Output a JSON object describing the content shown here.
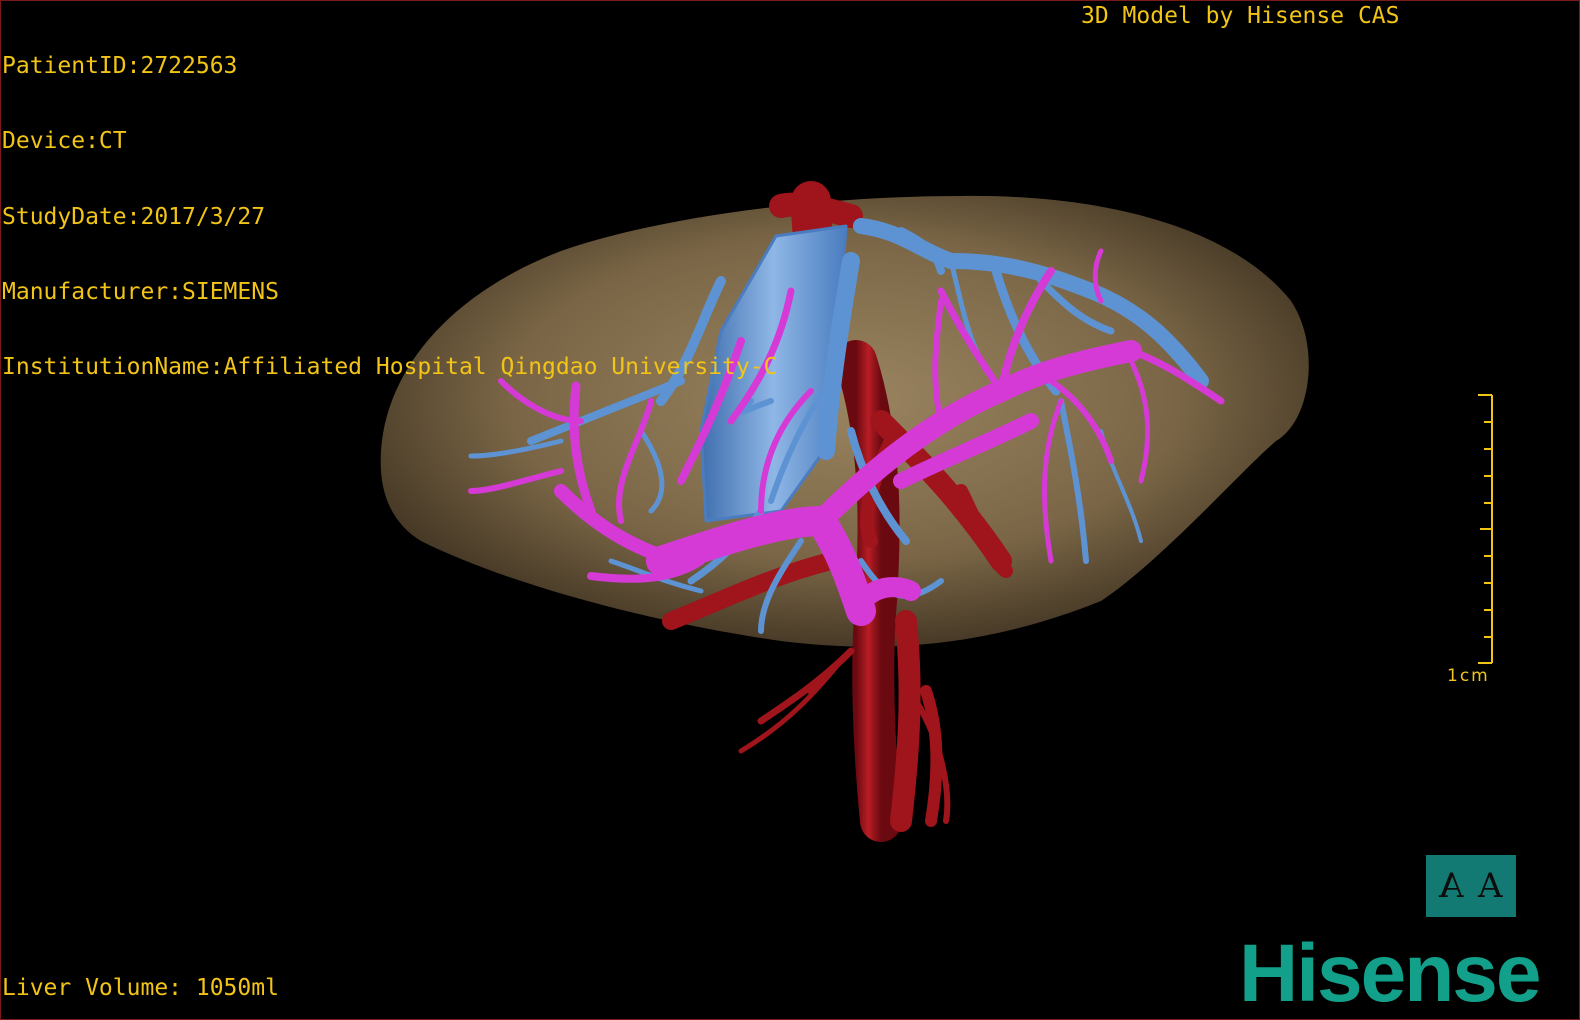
{
  "overlay": {
    "patient_id": "PatientID:2722563",
    "device": "Device:CT",
    "study_date": "StudyDate:2017/3/27",
    "manufacturer": "Manufacturer:SIEMENS",
    "institution": "InstitutionName:Affiliated Hospital Qingdao University-C",
    "credit": "3D Model by Hisense CAS",
    "liver_volume": "Liver Volume: 1050ml"
  },
  "scale_bar": {
    "label": "1cm"
  },
  "orientation_cube": {
    "left_glyph": "A",
    "right_glyph": "A"
  },
  "brand": {
    "logo_text": "Hisense"
  },
  "colors": {
    "overlay_text": "#f2c417",
    "liver": "#8a7350",
    "portal_vein": "#d63ad6",
    "hepatic_vein": "#5e93d3",
    "artery": "#a0141b",
    "orientation_bg": "#127a72",
    "brand": "#12a08a"
  }
}
